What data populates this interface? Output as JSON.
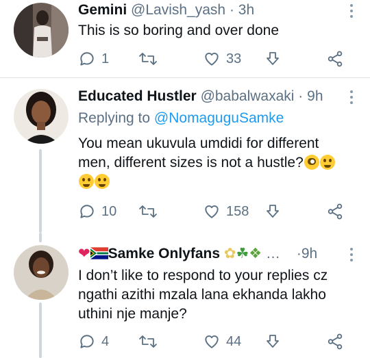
{
  "tweets": [
    {
      "name": "Gemini",
      "handle": "@Lavish_yash",
      "time": "3h",
      "replying_label": "",
      "replying_to": "",
      "text": "This is so boring and over done",
      "replies": "1",
      "retweets": "",
      "likes": "33"
    },
    {
      "name": "Educated Hustler",
      "handle": "@babalwaxaki",
      "time": "9h",
      "replying_label": "Replying to",
      "replying_to": "@NomaguguSamke",
      "text_line1": "You mean ukuvula umdidi for different",
      "text_line2": "men, different sizes is not a hustle?",
      "replies": "10",
      "retweets": "",
      "likes": "158"
    },
    {
      "name": "Samke Onlyfans",
      "handle": "…",
      "time": "9h",
      "text_line1": "I don’t like to respond to your replies cz",
      "text_line2": "ngathi azithi mzala lana ekhanda lakho",
      "text_line3": "uthini nje manje?",
      "replies": "4",
      "retweets": "",
      "likes": "44"
    }
  ],
  "separator": "·",
  "icons": [
    "reply-icon",
    "retweet-icon",
    "like-icon",
    "download-icon",
    "share-icon",
    "more-icon"
  ],
  "colors": {
    "accent": "#1d9bf0",
    "muted": "#5b7083",
    "text": "#0f1419",
    "divider": "#dfe3e6"
  }
}
